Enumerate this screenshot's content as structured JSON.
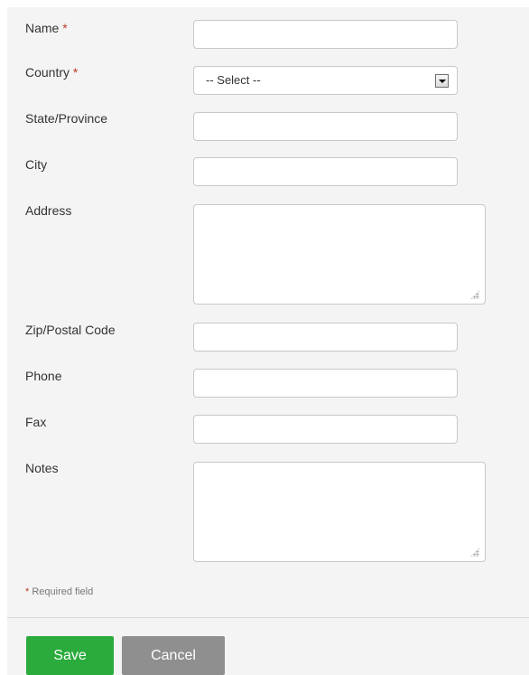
{
  "form": {
    "fields": {
      "name": {
        "label": "Name",
        "required_mark": "*",
        "value": ""
      },
      "country": {
        "label": "Country",
        "required_mark": "*",
        "selected": "-- Select --"
      },
      "state": {
        "label": "State/Province",
        "value": ""
      },
      "city": {
        "label": "City",
        "value": ""
      },
      "address": {
        "label": "Address",
        "value": ""
      },
      "zip": {
        "label": "Zip/Postal Code",
        "value": ""
      },
      "phone": {
        "label": "Phone",
        "value": ""
      },
      "fax": {
        "label": "Fax",
        "value": ""
      },
      "notes": {
        "label": "Notes",
        "value": ""
      }
    },
    "required_note": {
      "mark": "*",
      "text": "Required field"
    },
    "buttons": {
      "save_label": "Save",
      "cancel_label": "Cancel"
    }
  },
  "colors": {
    "panel_bg": "#f4f4f4",
    "required_mark": "#c0392b",
    "save_button": "#2aab3c",
    "cancel_button": "#8f8f8f"
  },
  "icons": {
    "select_arrow": "chevron-down-icon",
    "resize_grip": "resize-grip-icon"
  }
}
